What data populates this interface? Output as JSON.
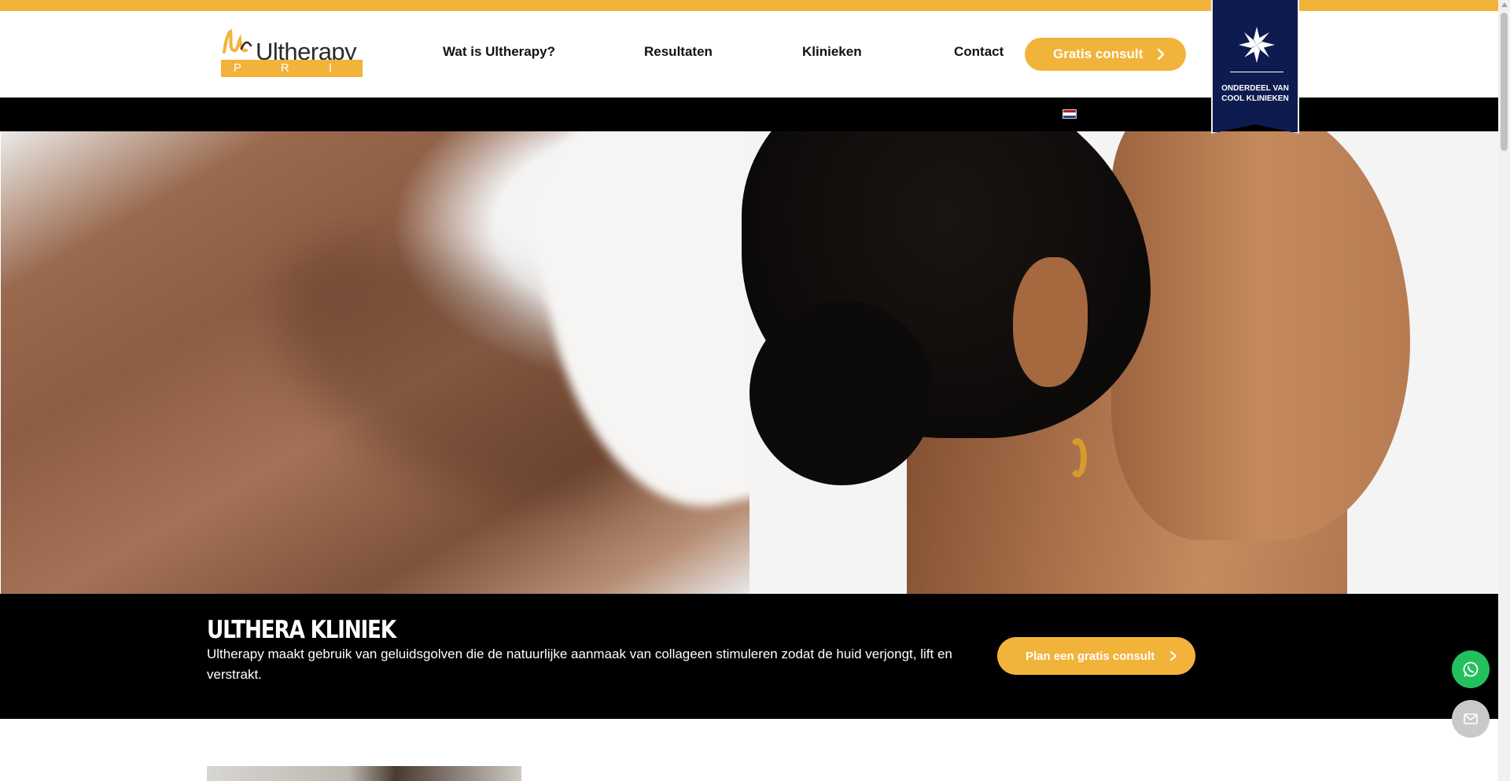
{
  "header": {
    "logo": {
      "wordmark": "Ultherapy",
      "sub": "P R I M E"
    },
    "nav": [
      {
        "label": "Wat is Ultherapy?"
      },
      {
        "label": "Resultaten"
      },
      {
        "label": "Klinieken"
      },
      {
        "label": "Contact"
      }
    ],
    "cta_label": "Gratis consult",
    "badge": {
      "line1": "ONDERDEEL VAN",
      "line2": "COOL KLINIEKEN"
    }
  },
  "language": {
    "current": "nl-flag"
  },
  "hero": {
    "left_image": "neck-collarbone-photo",
    "right_image": "woman-profile-photo"
  },
  "info": {
    "title": "ULTHERA KLINIEK",
    "text": "Ultherapy maakt gebruik van geluidsgolven die de natuurlijke aanmaak van collageen stimuleren zodat de huid verjongt, lift en verstrakt.",
    "cta_label": "Plan een gratis consult"
  },
  "floating": {
    "whatsapp": "whatsapp-icon",
    "mail": "mail-icon"
  },
  "colors": {
    "accent": "#f2b33a",
    "badge": "#0e1b4f",
    "band": "#000000",
    "whatsapp": "#25c05e"
  }
}
